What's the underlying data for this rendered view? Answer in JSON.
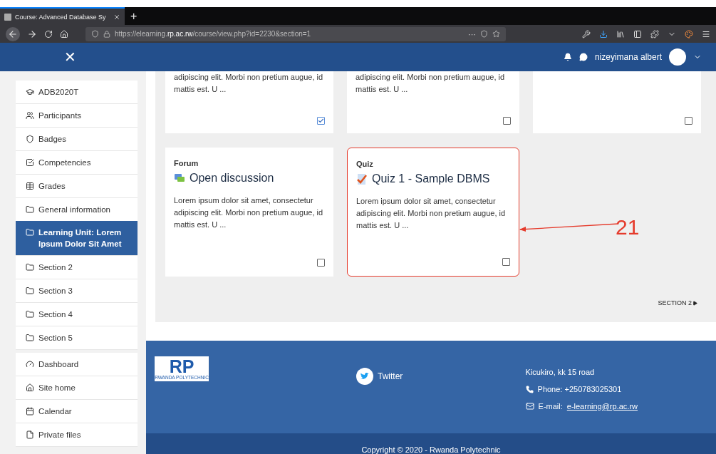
{
  "browser": {
    "tab_title": "Course: Advanced Database Sy",
    "new_tab": "+",
    "url": "https://elearning.**rp.ac.rw**/course/view.php?id=2230&section=1",
    "page_actions": "···"
  },
  "header": {
    "close": "✕",
    "user_name": "nizeyimana albert"
  },
  "sidebar": {
    "groups": [
      [
        {
          "label": "ADB2020T",
          "selected": false
        },
        {
          "label": "Participants",
          "selected": false
        },
        {
          "label": "Badges",
          "selected": false
        },
        {
          "label": "Competencies",
          "selected": false
        },
        {
          "label": "Grades",
          "selected": false
        },
        {
          "label": "General information",
          "selected": false
        },
        {
          "label": "Learning Unit: Lorem Ipsum Dolor Sit Amet",
          "selected": true
        },
        {
          "label": "Section 2",
          "selected": false
        },
        {
          "label": "Section 3",
          "selected": false
        },
        {
          "label": "Section 4",
          "selected": false
        },
        {
          "label": "Section 5",
          "selected": false
        }
      ],
      [
        {
          "label": "Dashboard",
          "selected": false
        },
        {
          "label": "Site home",
          "selected": false
        },
        {
          "label": "Calendar",
          "selected": false
        },
        {
          "label": "Private files",
          "selected": false
        }
      ]
    ]
  },
  "cards": [
    {
      "kind": "partial",
      "description": "adipiscing elit. Morbi non pretium augue, id mattis est. U ...",
      "checked": true,
      "highlighted": false
    },
    {
      "kind": "partial",
      "description": "adipiscing elit. Morbi non pretium augue, id mattis est. U ...",
      "checked": false,
      "highlighted": false
    },
    {
      "kind": "partial",
      "checked": false,
      "highlighted": false
    },
    {
      "kind": "forum",
      "type_label": "Forum",
      "title": "Open discussion",
      "description": "Lorem ipsum dolor sit amet, consectetur adipiscing elit. Morbi non pretium augue, id mattis est. U ...",
      "checked": false,
      "highlighted": false
    },
    {
      "kind": "quiz",
      "type_label": "Quiz",
      "title": "Quiz 1 - Sample DBMS",
      "description": "Lorem ipsum dolor sit amet, consectetur adipiscing elit. Morbi non pretium augue, id mattis est. U ...",
      "checked": false,
      "highlighted": true
    }
  ],
  "annotation": {
    "label": "21"
  },
  "next_section": "SECTION 2",
  "footer": {
    "logo": {
      "letters": "RP",
      "subtitle": "RWANDA POLYTECHNIC"
    },
    "twitter": "Twitter",
    "address": "Kicukiro, kk 15 road",
    "phone": "Phone: +250783025301",
    "email_label": "E-mail:",
    "email": "e-learning@rp.ac.rw",
    "copyright": "Copyright © 2020 - Rwanda Polytechnic"
  }
}
